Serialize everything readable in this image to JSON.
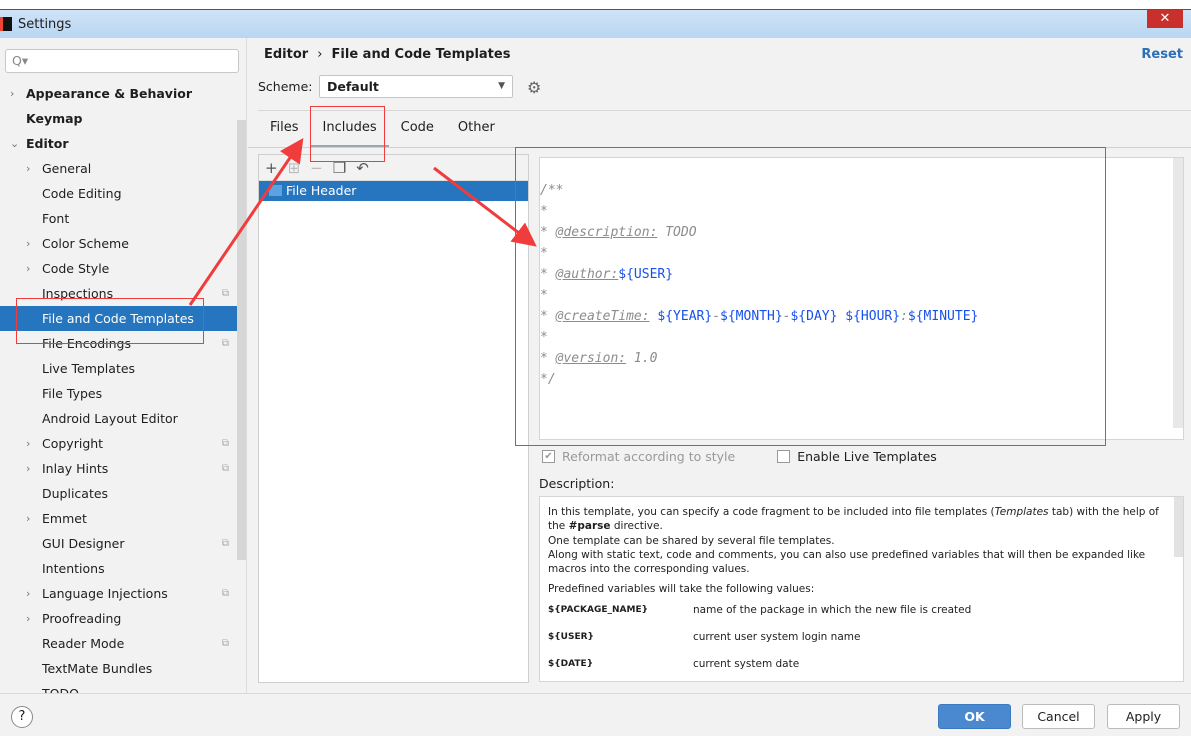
{
  "window": {
    "title": "Settings",
    "close": "✕",
    "tab_number": "2"
  },
  "search": {
    "placeholder": "Q▾"
  },
  "tree": [
    {
      "label": "Appearance & Behavior",
      "level": 0,
      "chev": "›",
      "bold": true
    },
    {
      "label": "Keymap",
      "level": 0,
      "chev": "",
      "bold": true
    },
    {
      "label": "Editor",
      "level": 0,
      "chev": "⌄",
      "bold": true
    },
    {
      "label": "General",
      "level": 1,
      "chev": "›"
    },
    {
      "label": "Code Editing",
      "level": 1,
      "chev": ""
    },
    {
      "label": "Font",
      "level": 1,
      "chev": ""
    },
    {
      "label": "Color Scheme",
      "level": 1,
      "chev": "›"
    },
    {
      "label": "Code Style",
      "level": 1,
      "chev": "›"
    },
    {
      "label": "Inspections",
      "level": 1,
      "chev": "",
      "copy": true
    },
    {
      "label": "File and Code Templates",
      "level": 1,
      "chev": "",
      "selected": true
    },
    {
      "label": "File Encodings",
      "level": 1,
      "chev": "",
      "copy": true
    },
    {
      "label": "Live Templates",
      "level": 1,
      "chev": ""
    },
    {
      "label": "File Types",
      "level": 1,
      "chev": ""
    },
    {
      "label": "Android Layout Editor",
      "level": 1,
      "chev": ""
    },
    {
      "label": "Copyright",
      "level": 1,
      "chev": "›",
      "copy": true
    },
    {
      "label": "Inlay Hints",
      "level": 1,
      "chev": "›",
      "copy": true
    },
    {
      "label": "Duplicates",
      "level": 1,
      "chev": ""
    },
    {
      "label": "Emmet",
      "level": 1,
      "chev": "›"
    },
    {
      "label": "GUI Designer",
      "level": 1,
      "chev": "",
      "copy": true
    },
    {
      "label": "Intentions",
      "level": 1,
      "chev": ""
    },
    {
      "label": "Language Injections",
      "level": 1,
      "chev": "›",
      "copy": true
    },
    {
      "label": "Proofreading",
      "level": 1,
      "chev": "›"
    },
    {
      "label": "Reader Mode",
      "level": 1,
      "chev": "",
      "copy": true
    },
    {
      "label": "TextMate Bundles",
      "level": 1,
      "chev": ""
    },
    {
      "label": "TODO",
      "level": 1,
      "chev": ""
    }
  ],
  "header": {
    "crumb_parent": "Editor",
    "crumb_sep": "›",
    "crumb_current": "File and Code Templates",
    "reset": "Reset"
  },
  "scheme": {
    "label": "Scheme:",
    "value": "Default"
  },
  "tabs": [
    {
      "label": "Files"
    },
    {
      "label": "Includes",
      "active": true
    },
    {
      "label": "Code"
    },
    {
      "label": "Other"
    }
  ],
  "list": {
    "items": [
      "File Header"
    ]
  },
  "editor": {
    "lines": [
      [
        {
          "t": "/**"
        }
      ],
      [
        {
          "t": "*"
        }
      ],
      [
        {
          "t": "* "
        },
        {
          "t": "@description:",
          "c": "tag"
        },
        {
          "t": " TODO"
        }
      ],
      [
        {
          "t": "*"
        }
      ],
      [
        {
          "t": "* "
        },
        {
          "t": "@author:",
          "c": "tag"
        },
        {
          "t": "${USER}",
          "c": "var"
        }
      ],
      [
        {
          "t": "*"
        }
      ],
      [
        {
          "t": "* "
        },
        {
          "t": "@createTime:",
          "c": "tag"
        },
        {
          "t": " "
        },
        {
          "t": "${YEAR}",
          "c": "var"
        },
        {
          "t": "-"
        },
        {
          "t": "${MONTH}",
          "c": "var"
        },
        {
          "t": "-"
        },
        {
          "t": "${DAY}",
          "c": "var"
        },
        {
          "t": " "
        },
        {
          "t": "${HOUR}",
          "c": "var"
        },
        {
          "t": ":"
        },
        {
          "t": "${MINUTE}",
          "c": "var"
        }
      ],
      [
        {
          "t": "*"
        }
      ],
      [
        {
          "t": "* "
        },
        {
          "t": "@version:",
          "c": "tag"
        },
        {
          "t": " 1.0"
        }
      ],
      [
        {
          "t": "*/"
        }
      ]
    ]
  },
  "options": {
    "reformat": "Reformat according to style",
    "reformat_checked": true,
    "live": "Enable Live Templates",
    "live_checked": false
  },
  "description": {
    "label": "Description:",
    "p1a": "In this template, you can specify a code fragment to be included into file templates (",
    "p1i": "Templates",
    "p1b": " tab) with the help of the ",
    "p1bold": "#parse",
    "p1c": " directive.",
    "p2": "One template can be shared by several file templates.",
    "p3": "Along with static text, code and comments, you can also use predefined variables that will then be expanded like macros into the corresponding values.",
    "p4": "Predefined variables will take the following values:",
    "vars": [
      {
        "name": "${PACKAGE_NAME}",
        "desc": "name of the package in which the new file is created"
      },
      {
        "name": "${USER}",
        "desc": "current user system login name"
      },
      {
        "name": "${DATE}",
        "desc": "current system date"
      }
    ]
  },
  "footer": {
    "help": "?",
    "ok": "OK",
    "cancel": "Cancel",
    "apply": "Apply"
  },
  "annotation_color": "#f03c3c"
}
